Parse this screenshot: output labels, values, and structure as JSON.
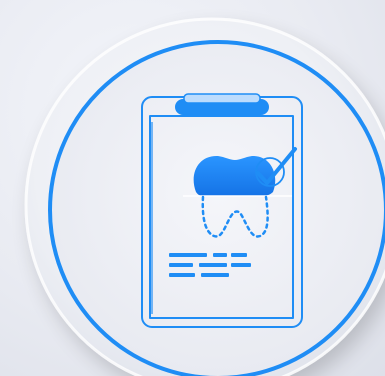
{
  "image": {
    "subject": "dental-record-clipboard-icon",
    "colors": {
      "background": "#e9ebf2",
      "disc": "#f2f3f7",
      "accent": "#1f8df5",
      "accent_light": "#bcdcfd"
    },
    "icons": [
      "outer-disc",
      "blue-ring",
      "clipboard-icon",
      "tooth-icon",
      "checkmark-icon",
      "text-lines"
    ]
  }
}
